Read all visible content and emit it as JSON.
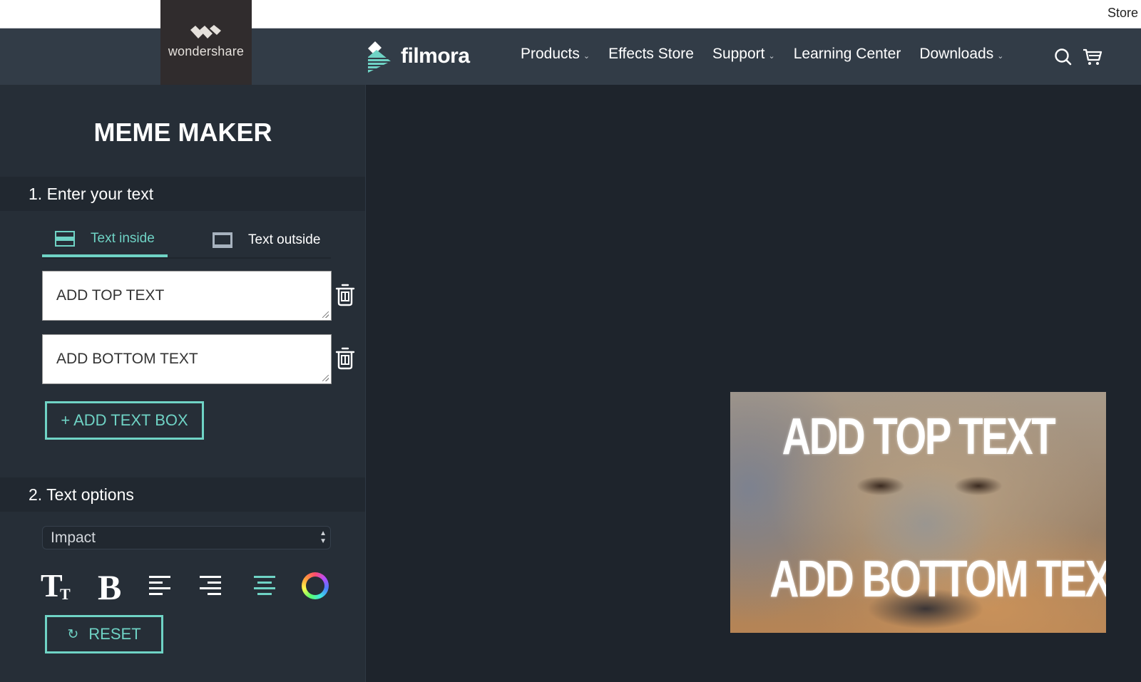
{
  "topbar": {
    "store_link": "Store"
  },
  "brand": {
    "parent": "wondershare",
    "product": "filmora"
  },
  "nav": {
    "items": [
      {
        "label": "Products",
        "dropdown": true
      },
      {
        "label": "Effects Store",
        "dropdown": false
      },
      {
        "label": "Support",
        "dropdown": true
      },
      {
        "label": "Learning Center",
        "dropdown": false
      },
      {
        "label": "Downloads",
        "dropdown": true
      }
    ],
    "icons": [
      "search-icon",
      "cart-icon"
    ]
  },
  "sidebar": {
    "title": "MEME MAKER",
    "section1": {
      "heading": "1. Enter your text",
      "tabs": [
        {
          "label": "Text inside",
          "active": true
        },
        {
          "label": "Text outside",
          "active": false
        }
      ],
      "fields": [
        {
          "value": "ADD TOP TEXT"
        },
        {
          "value": "ADD BOTTOM TEXT"
        }
      ],
      "add_button": "+ ADD TEXT BOX"
    },
    "section2": {
      "heading": "2. Text options",
      "font_select": "Impact",
      "tools": [
        "text-size-icon",
        "bold-icon",
        "align-left-icon",
        "align-right-icon",
        "align-center-icon",
        "color-picker-icon"
      ],
      "active_tool": "align-center-icon",
      "reset_button": "RESET"
    }
  },
  "preview": {
    "top_text": "ADD TOP TEXT",
    "bottom_text": "ADD BOTTOM TEXT",
    "image_subject": "bear"
  },
  "colors": {
    "accent": "#6fd3c5",
    "navbar": "#323c47",
    "sidebar": "#262e37",
    "canvas": "#1e242c"
  }
}
